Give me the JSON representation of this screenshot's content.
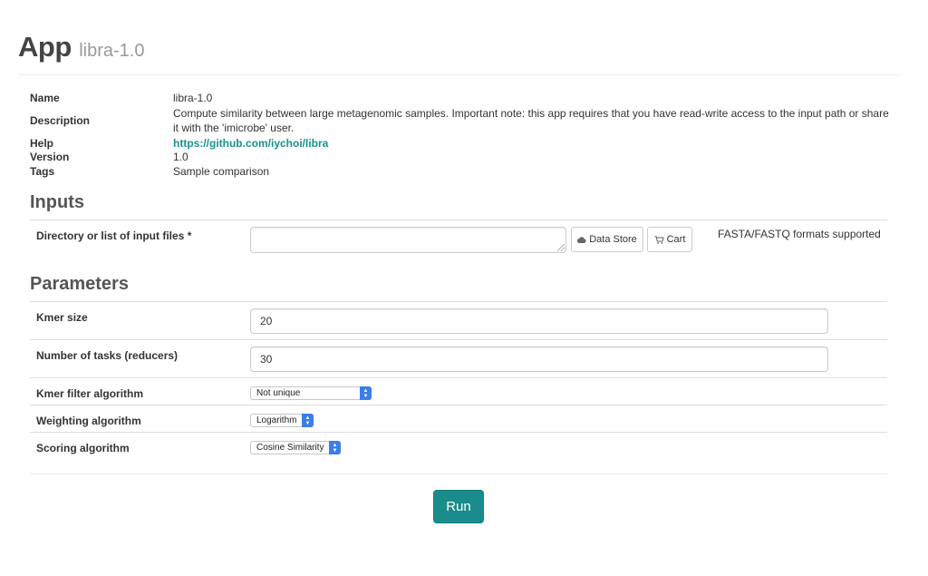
{
  "header": {
    "title": "App",
    "subtitle": "libra-1.0"
  },
  "info": {
    "name_label": "Name",
    "name_value": "libra-1.0",
    "description_label": "Description",
    "description_value": "Compute similarity between large metagenomic samples. Important note: this app requires that you have read-write access to the input path or share it with the 'imicrobe' user.",
    "help_label": "Help",
    "help_value": "https://github.com/iychoi/libra",
    "version_label": "Version",
    "version_value": "1.0",
    "tags_label": "Tags",
    "tags_value": "Sample comparison"
  },
  "inputs": {
    "heading": "Inputs",
    "files_label": "Directory or list of input files *",
    "files_value": "",
    "data_store_label": "Data Store",
    "cart_label": "Cart",
    "help_text": "FASTA/FASTQ formats supported"
  },
  "parameters": {
    "heading": "Parameters",
    "kmer_size_label": "Kmer size",
    "kmer_size_value": "20",
    "num_tasks_label": "Number of tasks (reducers)",
    "num_tasks_value": "30",
    "kmer_filter_label": "Kmer filter algorithm",
    "kmer_filter_value": "Not unique",
    "weighting_label": "Weighting algorithm",
    "weighting_value": "Logarithm",
    "scoring_label": "Scoring algorithm",
    "scoring_value": "Cosine Similarity"
  },
  "actions": {
    "run_label": "Run"
  },
  "colors": {
    "accent": "#1a8c8c",
    "link": "#17908f",
    "select_arrow": "#3d7de9"
  },
  "icons": {
    "data_store": "cloud-icon",
    "cart": "cart-icon"
  }
}
